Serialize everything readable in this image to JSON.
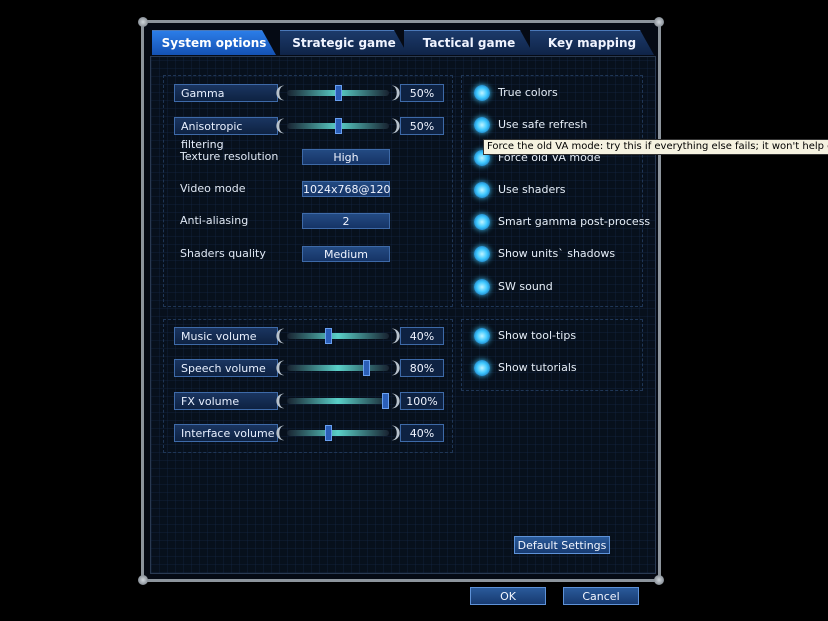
{
  "tabs": [
    {
      "label": "System options",
      "active": true
    },
    {
      "label": "Strategic game",
      "active": false
    },
    {
      "label": "Tactical game",
      "active": false
    },
    {
      "label": "Key mapping",
      "active": false
    }
  ],
  "display": {
    "gamma": {
      "label": "Gamma",
      "value": "50%",
      "fraction": 0.5
    },
    "anisotropic": {
      "label": "Anisotropic filtering",
      "value": "50%",
      "fraction": 0.5
    },
    "texture_resolution": {
      "label": "Texture resolution",
      "value": "High"
    },
    "video_mode": {
      "label": "Video mode",
      "value": "1024x768@120"
    },
    "anti_aliasing": {
      "label": "Anti-aliasing",
      "value": "2"
    },
    "shaders_quality": {
      "label": "Shaders quality",
      "value": "Medium"
    }
  },
  "audio": {
    "music": {
      "label": "Music volume",
      "value": "40%",
      "fraction": 0.4
    },
    "speech": {
      "label": "Speech volume",
      "value": "80%",
      "fraction": 0.8
    },
    "fx": {
      "label": "FX volume",
      "value": "100%",
      "fraction": 1.0
    },
    "interface": {
      "label": "Interface volume",
      "value": "40%",
      "fraction": 0.4
    }
  },
  "options": [
    {
      "label": "True colors",
      "checked": true
    },
    {
      "label": "Use safe refresh",
      "checked": true
    },
    {
      "label": "Force old VA mode",
      "checked": true
    },
    {
      "label": "Use shaders",
      "checked": true
    },
    {
      "label": "Smart gamma post-process",
      "checked": true
    },
    {
      "label": "Show units` shadows",
      "checked": true
    },
    {
      "label": "SW sound",
      "checked": true
    }
  ],
  "ui_options": [
    {
      "label": "Show tool-tips",
      "checked": true
    },
    {
      "label": "Show tutorials",
      "checked": true
    }
  ],
  "tooltip": "Force the old VA mode: try this if everything else fails; it won't help either.",
  "buttons": {
    "default_settings": "Default Settings",
    "ok": "OK",
    "cancel": "Cancel"
  },
  "colors": {
    "accent": "#2b7de8",
    "check": "#3ec8ff",
    "frame": "#8c949c"
  }
}
